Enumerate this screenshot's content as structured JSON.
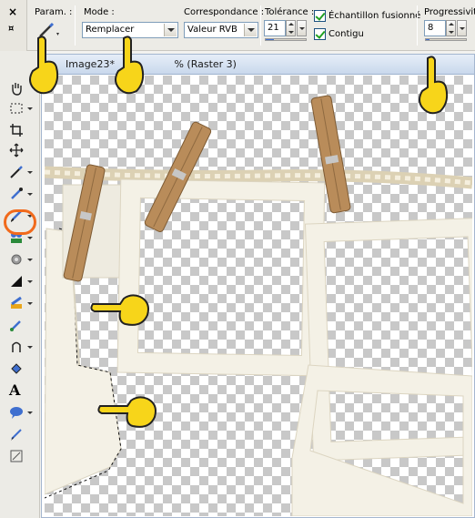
{
  "options_bar": {
    "param_label": "Param. :",
    "mode_label": "Mode :",
    "mode_value": "Remplacer",
    "match_label": "Correspondance :",
    "match_value": "Valeur RVB",
    "tolerance_label": "Tolérance :",
    "tolerance_value": "21",
    "sample_merged_label": "Échantillon fusionné",
    "sample_merged_checked": true,
    "contiguous_label": "Contigu",
    "contiguous_checked": true,
    "feather_label": "Progressivité",
    "feather_value": "8",
    "dock_close": "×",
    "dock_pin": "¤"
  },
  "toolbar": {
    "items": [
      {
        "name": "pan-tool",
        "icon": "hand-icon"
      },
      {
        "name": "selection-tool",
        "icon": "marquee-icon"
      },
      {
        "name": "crop-tool",
        "icon": "crop-icon"
      },
      {
        "name": "move-tool",
        "icon": "move-icon"
      },
      {
        "name": "magic-wand-tool",
        "icon": "magic-wand-icon",
        "active": true
      },
      {
        "name": "dropper-tool",
        "icon": "dropper-icon"
      },
      {
        "name": "paintbrush-tool",
        "icon": "paintbrush-icon"
      },
      {
        "name": "clone-brush-tool",
        "icon": "clone-stamp-icon"
      },
      {
        "name": "dodge-tool",
        "icon": "dodge-icon"
      },
      {
        "name": "eraser-tool",
        "icon": "eraser-icon"
      },
      {
        "name": "fill-tool",
        "icon": "flood-fill-icon"
      },
      {
        "name": "picture-tube-tool",
        "icon": "picture-tube-icon"
      },
      {
        "name": "lasso-tool",
        "icon": "lasso-icon"
      },
      {
        "name": "fill-bucket-tool",
        "icon": "bucket-icon"
      },
      {
        "name": "text-tool",
        "icon": "text-icon",
        "label": "A"
      },
      {
        "name": "preset-shape-tool",
        "icon": "speech-bubble-icon"
      },
      {
        "name": "pen-tool",
        "icon": "pen-icon"
      },
      {
        "name": "deform-tool",
        "icon": "deform-icon"
      }
    ],
    "highlight_color": "#f16a1c"
  },
  "document": {
    "title_left": "Image23*",
    "title_right": "% (Raster 3)"
  },
  "colors": {
    "accent": "#3f6fcf",
    "frame": "#f4f1e6",
    "clothespin": "#b98c5a",
    "rope": "#e9e0c8",
    "hand": "#f7d51a"
  }
}
